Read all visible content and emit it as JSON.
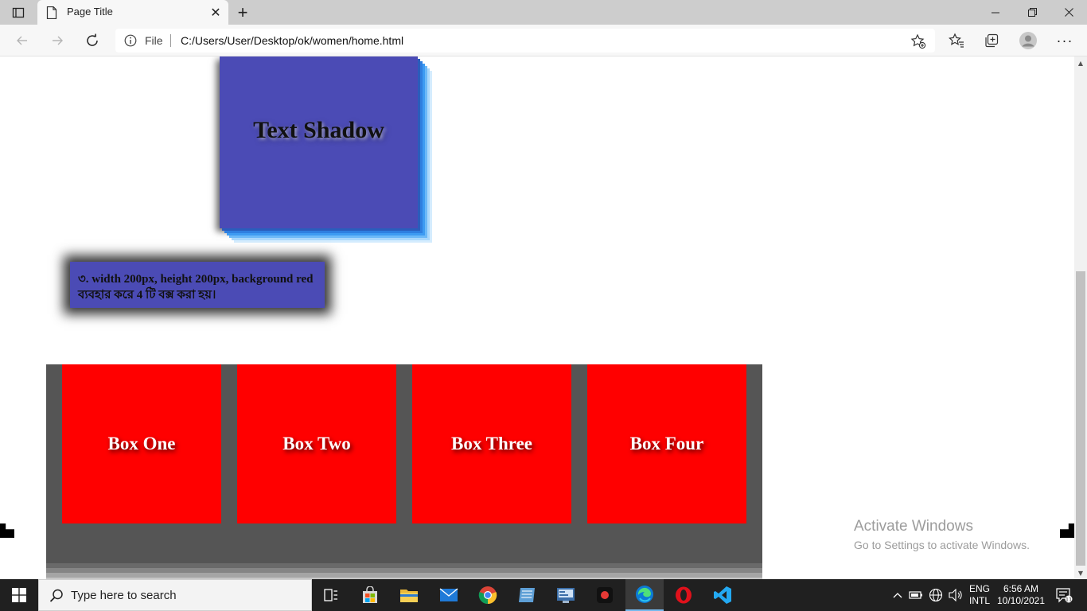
{
  "browser": {
    "tab": {
      "title": "Page Title"
    },
    "address": {
      "scheme_label": "File",
      "url": "C:/Users/User/Desktop/ok/women/home.html"
    }
  },
  "page": {
    "text_shadow_title": "Text Shadow",
    "note": "৩. width 200px, height 200px, background red ব্যবহার করে 4 টি বক্স করা হয়।",
    "boxes": [
      "Box One",
      "Box Two",
      "Box Three",
      "Box Four"
    ]
  },
  "watermark": {
    "title": "Activate Windows",
    "subtitle": "Go to Settings to activate Windows."
  },
  "taskbar": {
    "search_placeholder": "Type here to search",
    "language_line1": "ENG",
    "language_line2": "INTL",
    "time": "6:56 AM",
    "date": "10/10/2021",
    "notification_count": "11"
  },
  "colors": {
    "ts_box": "#4b4bb5",
    "red_box": "#ff0000",
    "taskbar": "#202020"
  }
}
